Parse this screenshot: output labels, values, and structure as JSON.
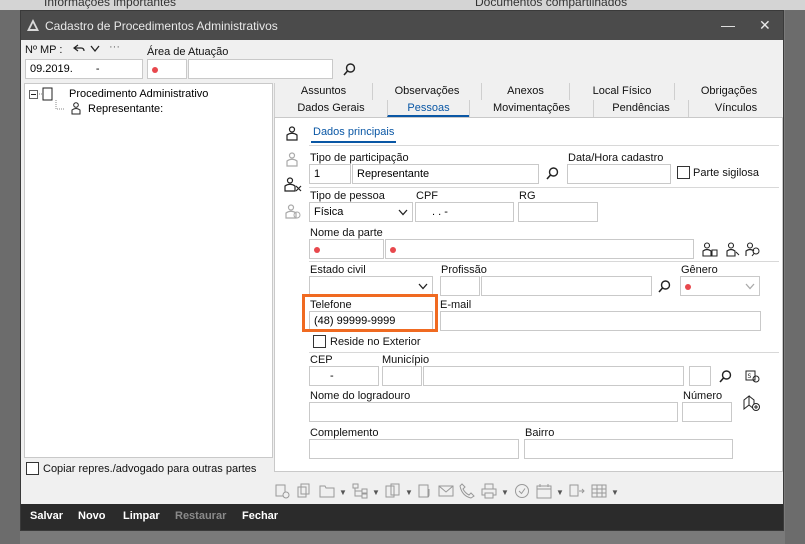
{
  "background": {
    "left_text": "Informações importantes",
    "right_text": "Documentos compartilhados"
  },
  "window": {
    "title": "Cadastro de Procedimentos Administrativos",
    "minimize": "—",
    "close": "✕"
  },
  "header": {
    "mp_label": "Nº MP :",
    "mp_value_prefix": "09.2019.",
    "mp_value_suffix": "-",
    "area_label": "Área de Atuação"
  },
  "tree": {
    "root": "Procedimento Administrativo",
    "child": "Representante:"
  },
  "copy_checkbox_label": "Copiar repres./advogado para outras partes",
  "tabs_row1": [
    "Assuntos",
    "Observações",
    "Anexos",
    "Local Físico",
    "Obrigações"
  ],
  "tabs_row2": [
    "Dados Gerais",
    "Pessoas",
    "Movimentações",
    "Pendências",
    "Vínculos"
  ],
  "active_tab": "Pessoas",
  "subtab": "Dados principais",
  "form": {
    "tipo_participacao_label": "Tipo de participação",
    "tipo_participacao_code": "1",
    "tipo_participacao_value": "Representante",
    "data_hora_label": "Data/Hora cadastro",
    "parte_sigilosa_label": "Parte sigilosa",
    "tipo_pessoa_label": "Tipo de pessoa",
    "tipo_pessoa_value": "Física",
    "cpf_label": "CPF",
    "cpf_value": ". .   -",
    "rg_label": "RG",
    "nome_parte_label": "Nome da parte",
    "estado_civil_label": "Estado civil",
    "profissao_label": "Profissão",
    "genero_label": "Gênero",
    "telefone_label": "Telefone",
    "telefone_value": "(48) 99999-9999",
    "email_label": "E-mail",
    "reside_exterior_label": "Reside no Exterior",
    "cep_label": "CEP",
    "cep_value": "-",
    "municipio_label": "Município",
    "logradouro_label": "Nome do logradouro",
    "numero_label": "Número",
    "complemento_label": "Complemento",
    "bairro_label": "Bairro"
  },
  "bottom_buttons": [
    "Salvar",
    "Novo",
    "Limpar",
    "Restaurar",
    "Fechar"
  ],
  "colors": {
    "accent": "#0a57a5",
    "required_dot": "#e8484d",
    "highlight": "#f06a21",
    "titlebar": "#4b4b4b",
    "bottom_bar": "#2b2b2b"
  }
}
